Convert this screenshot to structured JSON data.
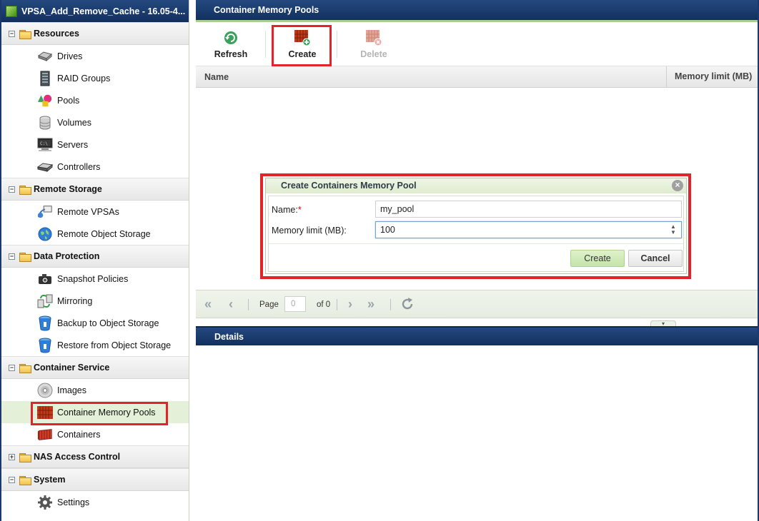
{
  "sidebar": {
    "title": "VPSA_Add_Remove_Cache - 16.05-4...",
    "groups": [
      {
        "label": "Resources",
        "toggle": "−",
        "items": [
          {
            "label": "Drives",
            "icon": "drive-icon"
          },
          {
            "label": "RAID Groups",
            "icon": "raid-icon"
          },
          {
            "label": "Pools",
            "icon": "pools-icon"
          },
          {
            "label": "Volumes",
            "icon": "volumes-icon"
          },
          {
            "label": "Servers",
            "icon": "servers-icon"
          },
          {
            "label": "Controllers",
            "icon": "controllers-icon"
          }
        ]
      },
      {
        "label": "Remote Storage",
        "toggle": "−",
        "items": [
          {
            "label": "Remote VPSAs",
            "icon": "remote-vpsa-icon"
          },
          {
            "label": "Remote Object Storage",
            "icon": "globe-icon"
          }
        ]
      },
      {
        "label": "Data Protection",
        "toggle": "−",
        "items": [
          {
            "label": "Snapshot Policies",
            "icon": "camera-icon"
          },
          {
            "label": "Mirroring",
            "icon": "mirroring-icon"
          },
          {
            "label": "Backup to Object Storage",
            "icon": "bucket-icon"
          },
          {
            "label": "Restore from Object Storage",
            "icon": "bucket-icon"
          }
        ]
      },
      {
        "label": "Container Service",
        "toggle": "−",
        "items": [
          {
            "label": "Images",
            "icon": "disc-icon"
          },
          {
            "label": "Container Memory Pools",
            "icon": "memory-pool-icon"
          },
          {
            "label": "Containers",
            "icon": "container-icon"
          }
        ]
      },
      {
        "label": "NAS Access Control",
        "toggle": "+",
        "items": []
      },
      {
        "label": "System",
        "toggle": "−",
        "items": [
          {
            "label": "Settings",
            "icon": "gear-icon"
          }
        ]
      }
    ]
  },
  "main": {
    "title": "Container Memory Pools",
    "toolbar": {
      "refresh": "Refresh",
      "create": "Create",
      "delete": "Delete"
    },
    "grid": {
      "columns": [
        "Name",
        "Memory limit (MB)"
      ],
      "rows": []
    },
    "pager": {
      "page_label": "Page",
      "page_value": "0",
      "of_label": "of 0"
    },
    "details_title": "Details"
  },
  "dialog": {
    "title": "Create Containers Memory Pool",
    "name_label": "Name:",
    "required_mark": "*",
    "name_value": "my_pool",
    "memory_label": "Memory limit (MB):",
    "memory_value": "100",
    "create_label": "Create",
    "cancel_label": "Cancel"
  },
  "colors": {
    "header_blue": "#1b3a6b",
    "accent_green": "#a9d18e",
    "highlight_red": "#e2232a"
  }
}
